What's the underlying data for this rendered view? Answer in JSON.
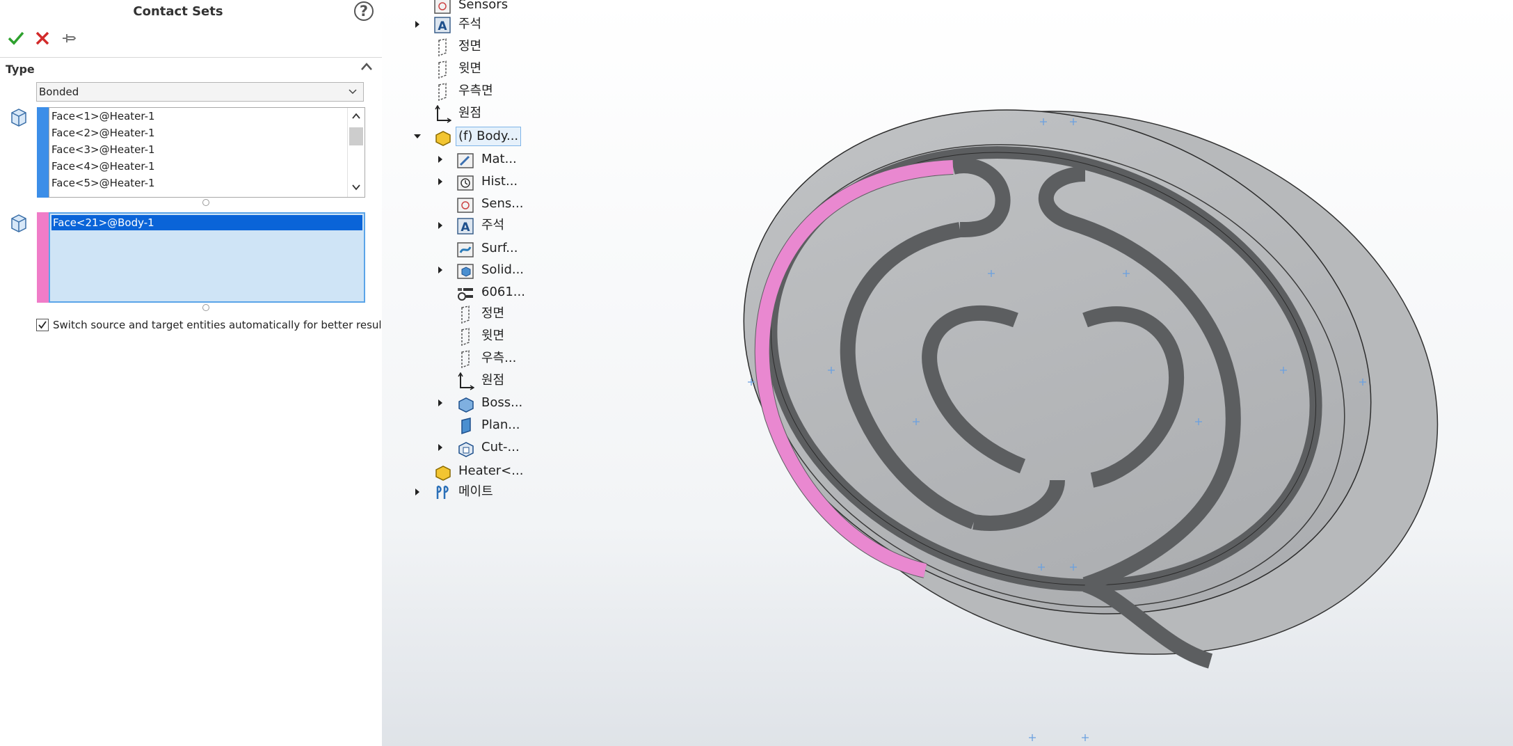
{
  "property_manager": {
    "title": "Contact Sets",
    "help_label": "?",
    "section_label": "Type",
    "type_value": "Bonded",
    "set1_items": [
      "Face<1>@Heater-1",
      "Face<2>@Heater-1",
      "Face<3>@Heater-1",
      "Face<4>@Heater-1",
      "Face<5>@Heater-1"
    ],
    "set2_items": [
      "Face<21>@Body-1"
    ],
    "switch_option_label": "Switch source and target entities automatically for better result.",
    "switch_option_checked": true,
    "colors": {
      "set1": "#3c8ee8",
      "set2": "#f07cc8",
      "selection": "#0a64d8",
      "ok": "#2ea12e",
      "cancel": "#d22a2a"
    }
  },
  "feature_tree": {
    "items": [
      {
        "label": "Sensors",
        "icon": "sensors-icon"
      },
      {
        "label": "주석",
        "icon": "annotations-icon"
      },
      {
        "label": "정면",
        "icon": "plane-icon"
      },
      {
        "label": "윗면",
        "icon": "plane-icon"
      },
      {
        "label": "우측면",
        "icon": "plane-icon"
      },
      {
        "label": "원점",
        "icon": "origin-icon"
      },
      {
        "label": "(f) Body...",
        "icon": "part-icon"
      },
      {
        "label": "Mat...",
        "icon": "material-icon"
      },
      {
        "label": "Hist...",
        "icon": "history-icon"
      },
      {
        "label": "Sens...",
        "icon": "sensors-icon"
      },
      {
        "label": "주석",
        "icon": "annotations-icon"
      },
      {
        "label": "Surf...",
        "icon": "surface-bodies-icon"
      },
      {
        "label": "Solid...",
        "icon": "solid-bodies-icon"
      },
      {
        "label": "6061...",
        "icon": "material-assigned-icon"
      },
      {
        "label": "정면",
        "icon": "plane-icon"
      },
      {
        "label": "윗면",
        "icon": "plane-icon"
      },
      {
        "label": "우측...",
        "icon": "plane-icon"
      },
      {
        "label": "원점",
        "icon": "origin-icon"
      },
      {
        "label": "Boss...",
        "icon": "boss-extrude-icon"
      },
      {
        "label": "Plan...",
        "icon": "sketch-plane-icon"
      },
      {
        "label": "Cut-...",
        "icon": "cut-extrude-icon"
      },
      {
        "label": "Heater<...",
        "icon": "part-icon"
      },
      {
        "label": "메이트",
        "icon": "mates-icon"
      }
    ]
  },
  "viewport": {
    "highlight_color": "#f08ad6",
    "model_color": "#b4b6b8"
  }
}
